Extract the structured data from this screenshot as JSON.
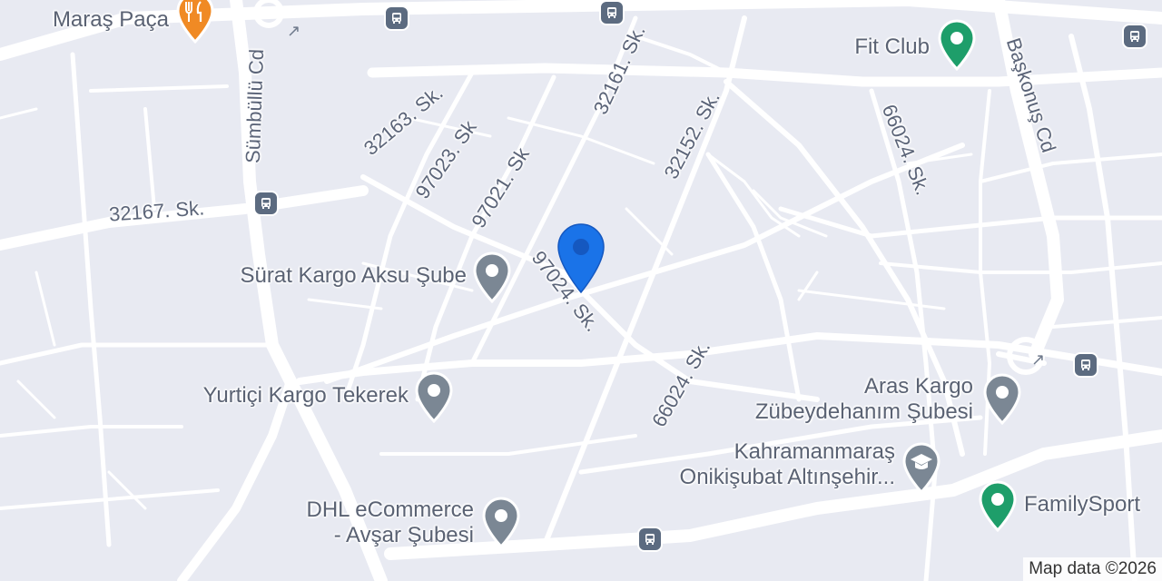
{
  "streets": {
    "s32163": "32163. Sk.",
    "s97023": "97023. Sk",
    "s97021": "97021. Sk",
    "s32161": "32161. Sk.",
    "s32152": "32152. Sk.",
    "s66024a": "66024. Sk.",
    "s66024b": "66024. Sk.",
    "s97024": "97024. Sk.",
    "s32167": "32167. Sk.",
    "sumbullu": "Sümbüllü Cd",
    "baskonus": "Başkonuş Cd"
  },
  "places": {
    "maras_paca": "Maraş Paça",
    "fit_club": "Fit Club",
    "surat_kargo": "Sürat Kargo Aksu Şube",
    "yurtici": "Yurtiçi Kargo Tekerek",
    "aras_line1": "Aras Kargo",
    "aras_line2": "Zübeydehanım Şubesi",
    "kmaras_line1": "Kahramanmaraş",
    "kmaras_line2": "Onikişubat Altınşehir...",
    "dhl_line1": "DHL eCommerce",
    "dhl_line2": "- Avşar Şubesi",
    "familysport": "FamilySport"
  },
  "icons": {
    "restaurant": "fork-knife-icon",
    "fitness": "fitness-pin-icon",
    "generic": "generic-place-pin-icon",
    "school": "graduation-cap-icon",
    "bus": "bus-stop-icon",
    "location": "location-marker-icon"
  },
  "colors": {
    "background": "#e8eaf2",
    "road": "#ffffff",
    "restaurant_pin": "#f08a24",
    "fitness_pin": "#1e9e6a",
    "generic_pin": "#7b8794",
    "school_pin": "#7b8794",
    "bus_stop": "#5c6b80",
    "location_marker": "#1a73e8"
  },
  "attribution": "Map data ©2026"
}
